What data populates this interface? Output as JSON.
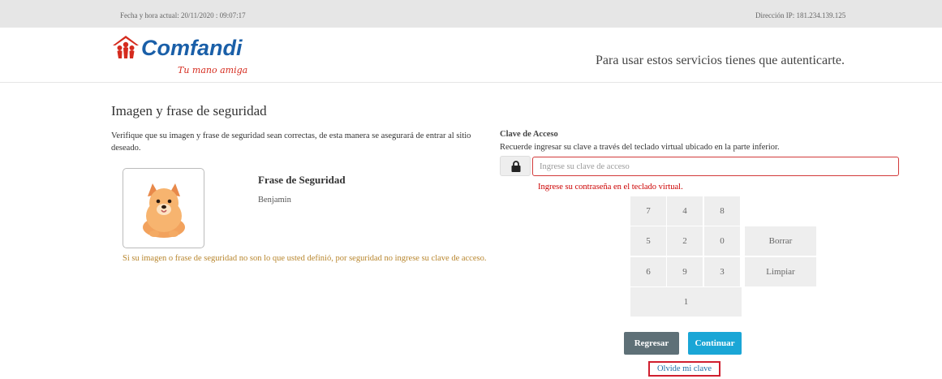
{
  "topbar": {
    "datetime": "Fecha y hora actual: 20/11/2020 : 09:07:17",
    "ip": "Dirección IP: 181.234.139.125"
  },
  "header": {
    "brand": "Comfandi",
    "tagline": "Tu mano amiga",
    "auth_message": "Para usar estos servicios tienes que autenticarte."
  },
  "security": {
    "title": "Imagen y frase de seguridad",
    "verify_text": "Verifique que su imagen y frase de seguridad sean correctas, de esta manera se asegurará de entrar al sitio deseado.",
    "phrase_title": "Frase de Seguridad",
    "phrase_value": "Benjamin",
    "warning": "Si su imagen o frase de seguridad no son lo que usted definió, por seguridad no ingrese su clave de acceso."
  },
  "access": {
    "title": "Clave de Acceso",
    "instructions": "Recuerde ingresar su clave a través del teclado virtual ubicado en la parte inferior.",
    "placeholder": "Ingrese su clave de acceso",
    "error": "Ingrese su contraseña en el teclado virtual."
  },
  "keypad": {
    "keys": [
      "7",
      "4",
      "8",
      "5",
      "2",
      "0",
      "6",
      "9",
      "3",
      "1"
    ],
    "delete_label": "Borrar",
    "clear_label": "Limpiar"
  },
  "actions": {
    "back_label": "Regresar",
    "continue_label": "Continuar",
    "forgot_label": "Olvide mi clave"
  },
  "colors": {
    "brand_blue": "#1a5fa8",
    "brand_red": "#d52b1e",
    "error": "#cc0000",
    "warning": "#b8862e",
    "continue": "#1aa6d6",
    "back": "#5e7077"
  },
  "icons": {
    "lock": "lock-icon",
    "pet_image": "security-image-dog"
  }
}
